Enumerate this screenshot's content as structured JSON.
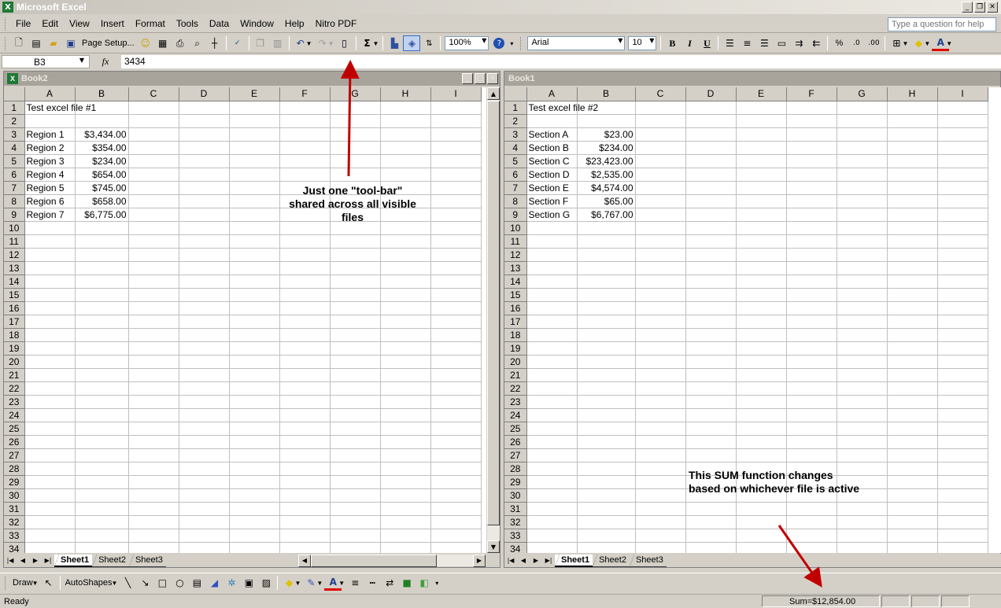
{
  "app": {
    "title": "Microsoft Excel",
    "icon_letter": "X"
  },
  "menu": {
    "items": [
      "File",
      "Edit",
      "View",
      "Insert",
      "Format",
      "Tools",
      "Data",
      "Window",
      "Help",
      "Nitro PDF"
    ],
    "help_placeholder": "Type a question for help"
  },
  "toolbar": {
    "page_setup": "Page Setup...",
    "zoom": "100%",
    "font": "Arial",
    "font_size": "10",
    "bold": "B",
    "italic": "I",
    "underline": "U",
    "percent": "%"
  },
  "formula_bar": {
    "name_box": "B3",
    "fx_label": "fx",
    "value": "3434"
  },
  "left_workbook": {
    "title": "Book2",
    "columns": [
      "A",
      "B",
      "C",
      "D",
      "E",
      "F",
      "G",
      "H",
      "I"
    ],
    "rows": [
      {
        "n": "1",
        "a": "Test excel file #1",
        "b": ""
      },
      {
        "n": "2",
        "a": "",
        "b": ""
      },
      {
        "n": "3",
        "a": "Region 1",
        "b": "$3,434.00"
      },
      {
        "n": "4",
        "a": "Region 2",
        "b": "$354.00"
      },
      {
        "n": "5",
        "a": "Region 3",
        "b": "$234.00"
      },
      {
        "n": "6",
        "a": "Region 4",
        "b": "$654.00"
      },
      {
        "n": "7",
        "a": "Region 5",
        "b": "$745.00"
      },
      {
        "n": "8",
        "a": "Region 6",
        "b": "$658.00"
      },
      {
        "n": "9",
        "a": "Region 7",
        "b": "$6,775.00"
      }
    ],
    "row_count": 34,
    "tabs": [
      "Sheet1",
      "Sheet2",
      "Sheet3"
    ],
    "active_tab": "Sheet1"
  },
  "right_workbook": {
    "title": "Book1",
    "columns": [
      "A",
      "B",
      "C",
      "D",
      "E",
      "F",
      "G",
      "H",
      "I"
    ],
    "rows": [
      {
        "n": "1",
        "a": "Test excel file #2",
        "b": ""
      },
      {
        "n": "2",
        "a": "",
        "b": ""
      },
      {
        "n": "3",
        "a": "Section A",
        "b": "$23.00"
      },
      {
        "n": "4",
        "a": "Section B",
        "b": "$234.00"
      },
      {
        "n": "5",
        "a": "Section C",
        "b": "$23,423.00"
      },
      {
        "n": "6",
        "a": "Section D",
        "b": "$2,535.00"
      },
      {
        "n": "7",
        "a": "Section E",
        "b": "$4,574.00"
      },
      {
        "n": "8",
        "a": "Section F",
        "b": "$65.00"
      },
      {
        "n": "9",
        "a": "Section G",
        "b": "$6,767.00"
      }
    ],
    "row_count": 34,
    "tabs": [
      "Sheet1",
      "Sheet2",
      "Sheet3"
    ],
    "active_tab": "Sheet1"
  },
  "drawing_toolbar": {
    "draw": "Draw",
    "autoshapes": "AutoShapes"
  },
  "status_bar": {
    "state": "Ready",
    "sum": "Sum=$12,854.00"
  },
  "annotations": {
    "toolbar_note_line1": "Just one \"tool-bar\"",
    "toolbar_note_line2": "shared across all visible",
    "toolbar_note_line3": "files",
    "sum_note_line1": "This SUM function changes",
    "sum_note_line2": "based on whichever file is active"
  },
  "colors": {
    "chrome": "#d4d0c8",
    "annotation_arrow": "#c00000",
    "excel_green": "#1e7a35"
  }
}
